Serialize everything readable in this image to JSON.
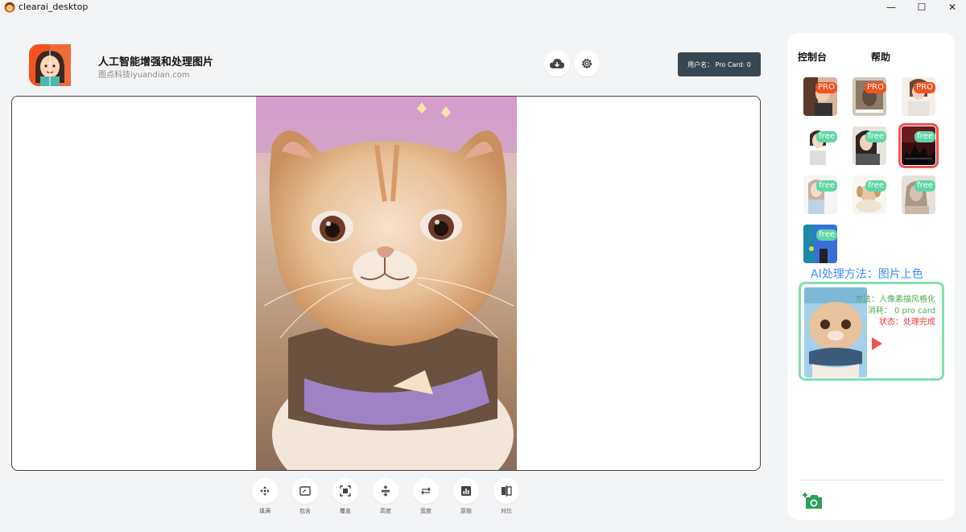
{
  "window": {
    "title": "clearai_desktop",
    "minimize": "—",
    "maximize": "☐",
    "close": "✕"
  },
  "header": {
    "app_name": "人工智能增强和处理图片",
    "subtitle": "图点科技iyuandian.com",
    "user_badge": "用户名： Pro Card: 0"
  },
  "toolbar": {
    "tools": [
      {
        "label": "填满",
        "icon": "move-icon"
      },
      {
        "label": "包含",
        "icon": "contain-icon"
      },
      {
        "label": "覆盖",
        "icon": "cover-icon"
      },
      {
        "label": "高度",
        "icon": "height-icon"
      },
      {
        "label": "宽度",
        "icon": "width-icon"
      },
      {
        "label": "原始",
        "icon": "original-icon"
      },
      {
        "label": "对比",
        "icon": "compare-icon"
      }
    ]
  },
  "panel": {
    "tabs": [
      "控制台",
      "帮助"
    ],
    "models": [
      {
        "badge": "PRO",
        "type": "pro"
      },
      {
        "badge": "PRO",
        "type": "pro"
      },
      {
        "badge": "PRO",
        "type": "pro"
      },
      {
        "badge": "free",
        "type": "free"
      },
      {
        "badge": "free",
        "type": "free"
      },
      {
        "badge": "free",
        "type": "free",
        "selected": true
      },
      {
        "badge": "free",
        "type": "free"
      },
      {
        "badge": "free",
        "type": "free"
      },
      {
        "badge": "free",
        "type": "free"
      },
      {
        "badge": "free",
        "type": "free"
      }
    ],
    "method_title": "AI处理方法：图片上色",
    "result": {
      "style": "方法：人像素描风格化",
      "cost": "消耗： 0 pro card",
      "status": "状态：处理完成"
    }
  },
  "colors": {
    "accent": "#3d8bfd",
    "pro": "#f4511e",
    "free": "#5ed6a5",
    "selected": "#ef5350",
    "badge_bg": "#37474f"
  }
}
